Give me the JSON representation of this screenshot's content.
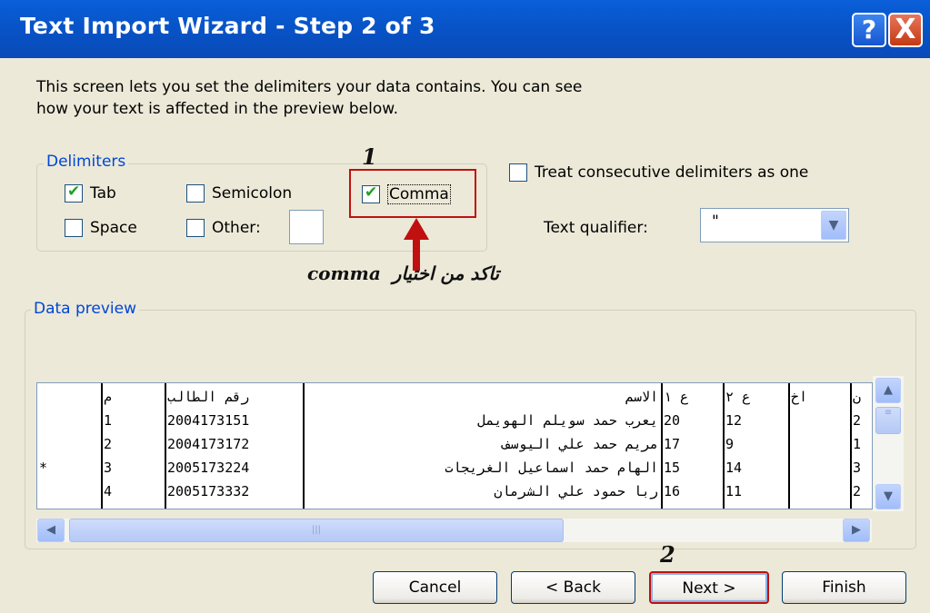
{
  "window": {
    "title": "Text Import Wizard - Step 2 of 3",
    "help_button": "?",
    "close_button": "X"
  },
  "description": {
    "line1": "This screen lets you set the delimiters your data contains.  You can see",
    "line2": "how your text is affected in the preview below."
  },
  "delimiters": {
    "legend": "Delimiters",
    "tab": {
      "label": "Tab",
      "checked": true
    },
    "semicolon": {
      "label": "Semicolon",
      "checked": false
    },
    "comma": {
      "label": "Comma",
      "checked": true
    },
    "space": {
      "label": "Space",
      "checked": false
    },
    "other": {
      "label": "Other:",
      "checked": false,
      "value": ""
    }
  },
  "options": {
    "treat_consecutive": {
      "label": "Treat consecutive delimiters as one",
      "checked": false
    },
    "text_qualifier_label": "Text qualifier:",
    "text_qualifier_value": "\""
  },
  "annotations": {
    "step1": "1",
    "step2": "2",
    "note_arabic": "تاكد من اختيار",
    "note_word": "comma"
  },
  "preview": {
    "legend": "Data preview",
    "rows": [
      [
        "",
        "م",
        "رقم الطالب",
        "الاسم",
        "ع ١",
        "ع ٢",
        "اخ",
        "ن"
      ],
      [
        "",
        "1",
        "2004173151",
        "يعرب حمد سويلم الهويمل",
        "20",
        "12",
        "",
        "2"
      ],
      [
        "",
        "2",
        "2004173172",
        "مريم حمد علي اليوسف",
        "17",
        "9",
        "",
        "1"
      ],
      [
        "*",
        "3",
        "2005173224",
        "الهام حمد اسماعيل الغريجات",
        "15",
        "14",
        "",
        "3"
      ],
      [
        "",
        "4",
        "2005173332",
        "ربا حمود علي الشرمان",
        "16",
        "11",
        "",
        "2"
      ]
    ]
  },
  "scrollbars": {
    "up_icon": "▲",
    "down_icon": "▼",
    "left_icon": "◀",
    "right_icon": "▶",
    "grip": "|||"
  },
  "buttons": {
    "cancel": "Cancel",
    "back": "< Back",
    "next": "Next >",
    "finish": "Finish"
  },
  "colors": {
    "title_bar": "#0a5fd9",
    "legend_text": "#0046d5",
    "highlight_frame": "#c01010",
    "annotation_arrow": "#c01010"
  }
}
